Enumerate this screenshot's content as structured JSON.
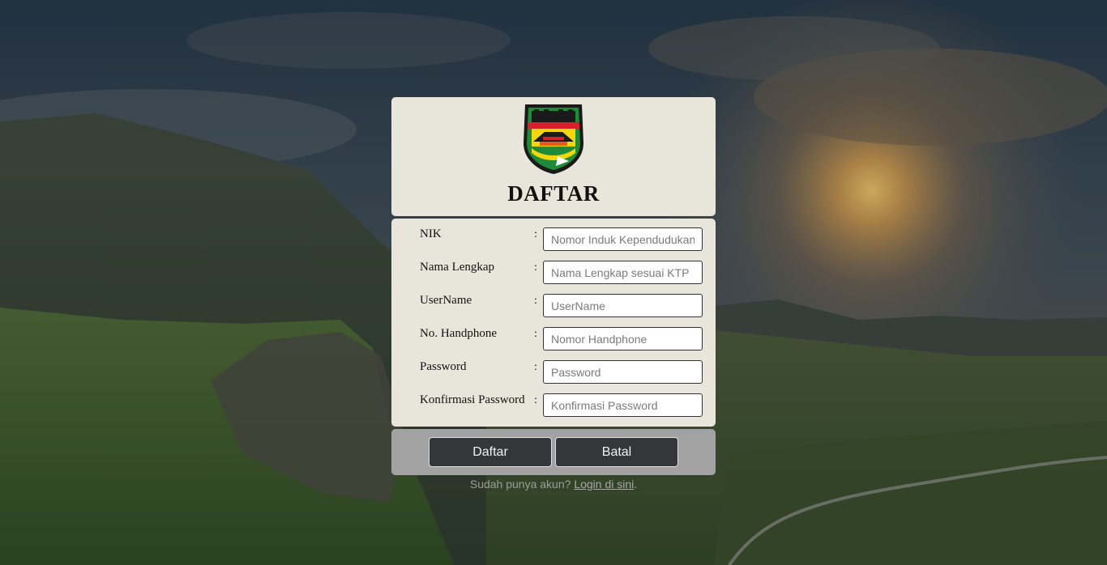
{
  "page": {
    "title": "DAFTAR",
    "logo_name": "emblem-logo",
    "accent_color": "#34363a"
  },
  "form": {
    "fields": [
      {
        "label": "NIK",
        "colon": ":",
        "placeholder": "Nomor Induk Kependudukan",
        "value": ""
      },
      {
        "label": "Nama Lengkap",
        "colon": ":",
        "placeholder": "Nama Lengkap sesuai KTP",
        "value": ""
      },
      {
        "label": "UserName",
        "colon": ":",
        "placeholder": "UserName",
        "value": ""
      },
      {
        "label": "No. Handphone",
        "colon": ":",
        "placeholder": "Nomor Handphone",
        "value": ""
      },
      {
        "label": "Password",
        "colon": ":",
        "placeholder": "Password",
        "value": ""
      },
      {
        "label": "Konfirmasi Password",
        "colon": ":",
        "placeholder": "Konfirmasi Password",
        "value": ""
      }
    ]
  },
  "buttons": {
    "submit_label": "Daftar",
    "cancel_label": "Batal"
  },
  "footer": {
    "text": "Sudah punya akun? ",
    "link_text": "Login di sini",
    "suffix": "."
  }
}
